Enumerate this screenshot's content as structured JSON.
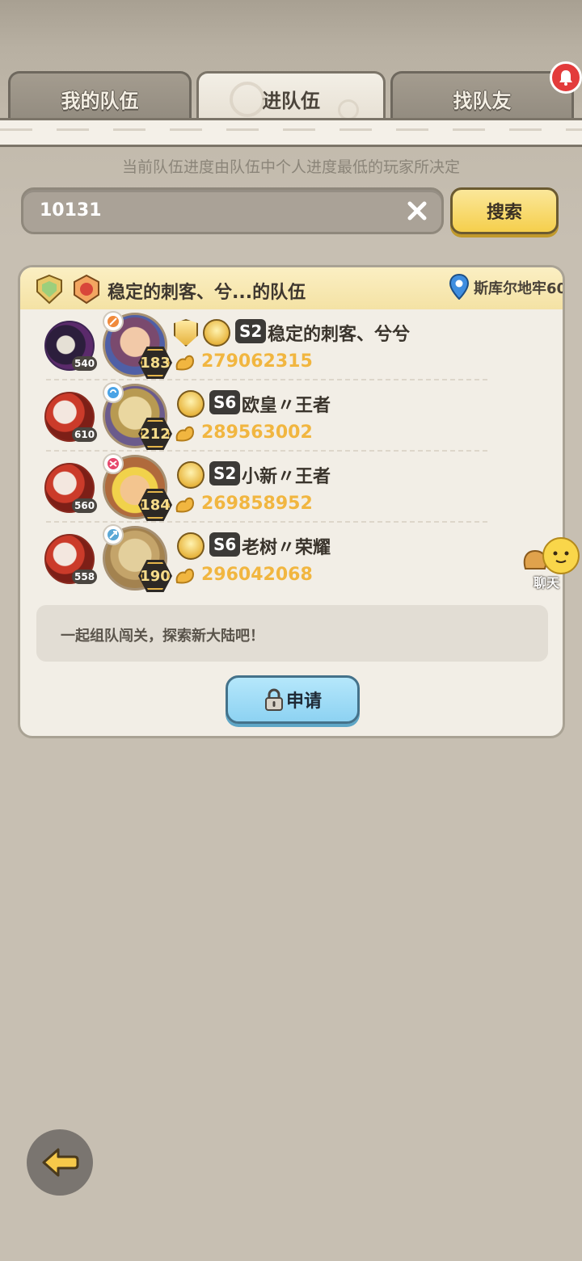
{
  "tabs": [
    {
      "label": "我的队伍"
    },
    {
      "label": "进队伍"
    },
    {
      "label": "找队友"
    }
  ],
  "subtitle": "当前队伍进度由队伍中个人进度最低的玩家所决定",
  "search": {
    "value": "10131",
    "button_label": "搜索"
  },
  "team": {
    "name": "稳定的刺客、兮...的队伍",
    "location": "斯库尔地牢60",
    "members": [
      {
        "pet_level": "540",
        "level": "183",
        "season": "S2",
        "name": "稳定的刺客、兮兮",
        "power": "279062315",
        "has_guild": true
      },
      {
        "pet_level": "610",
        "level": "212",
        "season": "S6",
        "name": "欧皇〃王者",
        "power": "289563002",
        "has_guild": false
      },
      {
        "pet_level": "560",
        "level": "184",
        "season": "S2",
        "name": "小新〃王者",
        "power": "269858952",
        "has_guild": false
      },
      {
        "pet_level": "558",
        "level": "190",
        "season": "S6",
        "name": "老树〃荣耀",
        "power": "296042068",
        "has_guild": false
      }
    ],
    "slogan": "一起组队闯关，探索新大陆吧！",
    "apply_label": "申请"
  },
  "chat": {
    "label": "聊天"
  },
  "colors": {
    "accent_yellow": "#f5cf4c",
    "power_gold": "#f1b640",
    "apply_blue": "#8dd2f2"
  }
}
